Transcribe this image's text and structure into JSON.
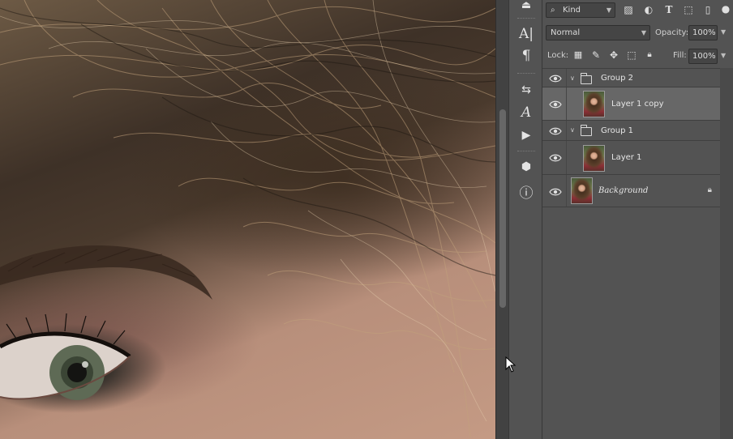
{
  "tools": {
    "character_glyph": "A|",
    "paragraph_glyph": "¶",
    "glyph_a": "A",
    "play_glyph": "▶",
    "info_glyph": "ⓘ"
  },
  "layers_panel": {
    "filter_kind": "Kind",
    "blend_mode": "Normal",
    "opacity_label": "Opacity:",
    "opacity_value": "100%",
    "lock_label": "Lock:",
    "fill_label": "Fill:",
    "fill_value": "100%",
    "layers": [
      {
        "name": "Group 2",
        "type": "group"
      },
      {
        "name": "Layer 1 copy",
        "type": "pixel",
        "selected": true
      },
      {
        "name": "Group 1",
        "type": "group"
      },
      {
        "name": "Layer 1",
        "type": "pixel"
      },
      {
        "name": "Background",
        "type": "background",
        "locked": true
      }
    ]
  },
  "colors": {
    "panel_bg": "#535353",
    "selected_row": "#676767",
    "field_bg": "#454545"
  }
}
